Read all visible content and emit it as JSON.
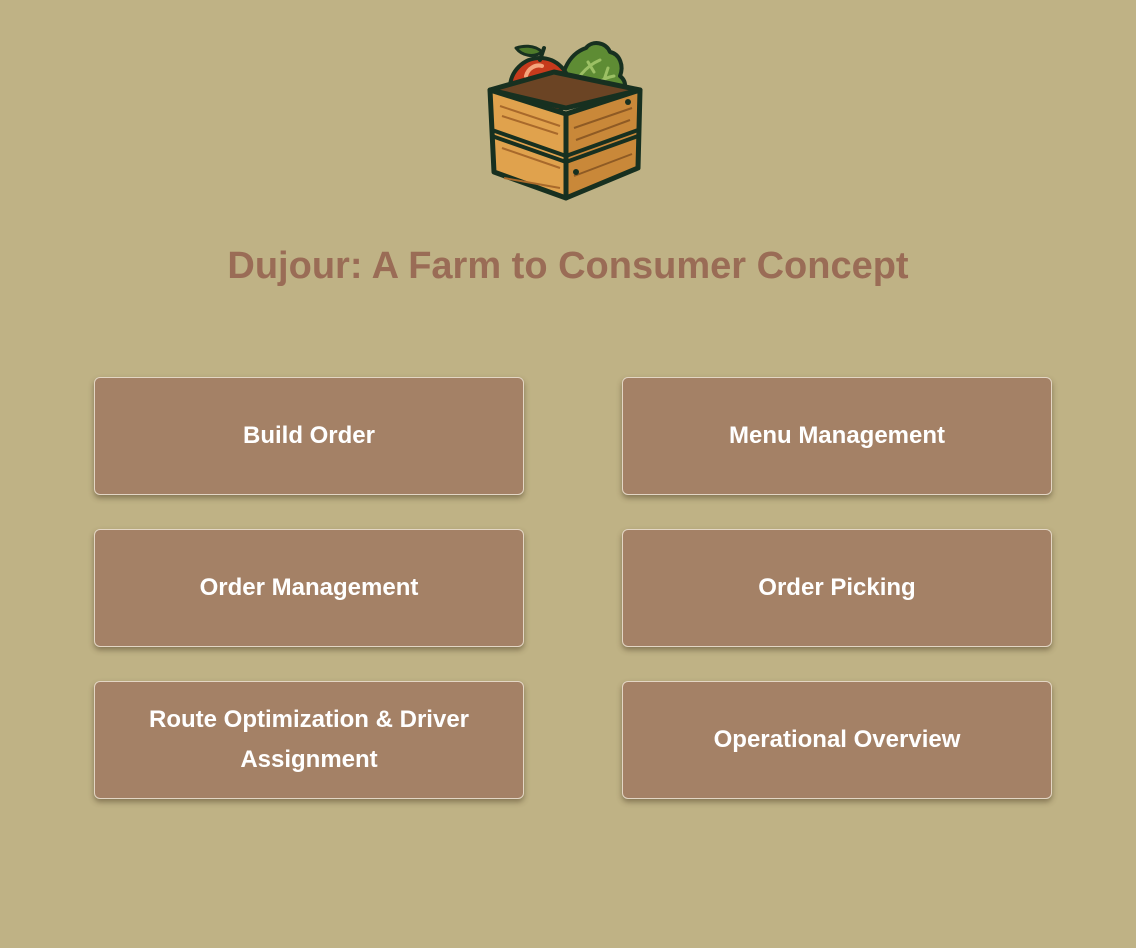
{
  "header": {
    "logo_icon": "produce-crate-icon",
    "title": "Dujour: A Farm to Consumer Concept"
  },
  "menu": {
    "buttons": [
      {
        "label": "Build Order"
      },
      {
        "label": "Menu Management"
      },
      {
        "label": "Order Management"
      },
      {
        "label": "Order Picking"
      },
      {
        "label": "Route Optimization & Driver Assignment"
      },
      {
        "label": "Operational Overview"
      }
    ]
  },
  "colors": {
    "background": "#bfb285",
    "title": "#9a6c56",
    "button": "#a48166",
    "button_text": "#ffffff"
  }
}
